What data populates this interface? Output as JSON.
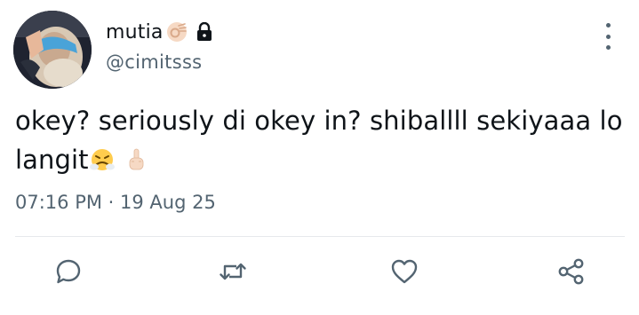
{
  "author": {
    "display_name": "mutia",
    "handle": "@cimitsss",
    "name_emoji": "ok-hand-emoji",
    "protected_icon": "lock-icon"
  },
  "tweet": {
    "line1": "okey?  seriously di okey in?  shiballll sekiyaaa lo",
    "line2": "langit",
    "emojis": [
      "face-with-steam-from-nose-emoji",
      "middle-finger-emoji"
    ],
    "timestamp": "07:16 PM · 19 Aug 25"
  },
  "actions": {
    "icons": [
      "reply-icon",
      "retweet-icon",
      "like-icon",
      "share-icon"
    ]
  },
  "colors": {
    "text_primary": "#0f1419",
    "text_secondary": "#536471",
    "divider": "#e6e9ec",
    "background": "#ffffff"
  }
}
